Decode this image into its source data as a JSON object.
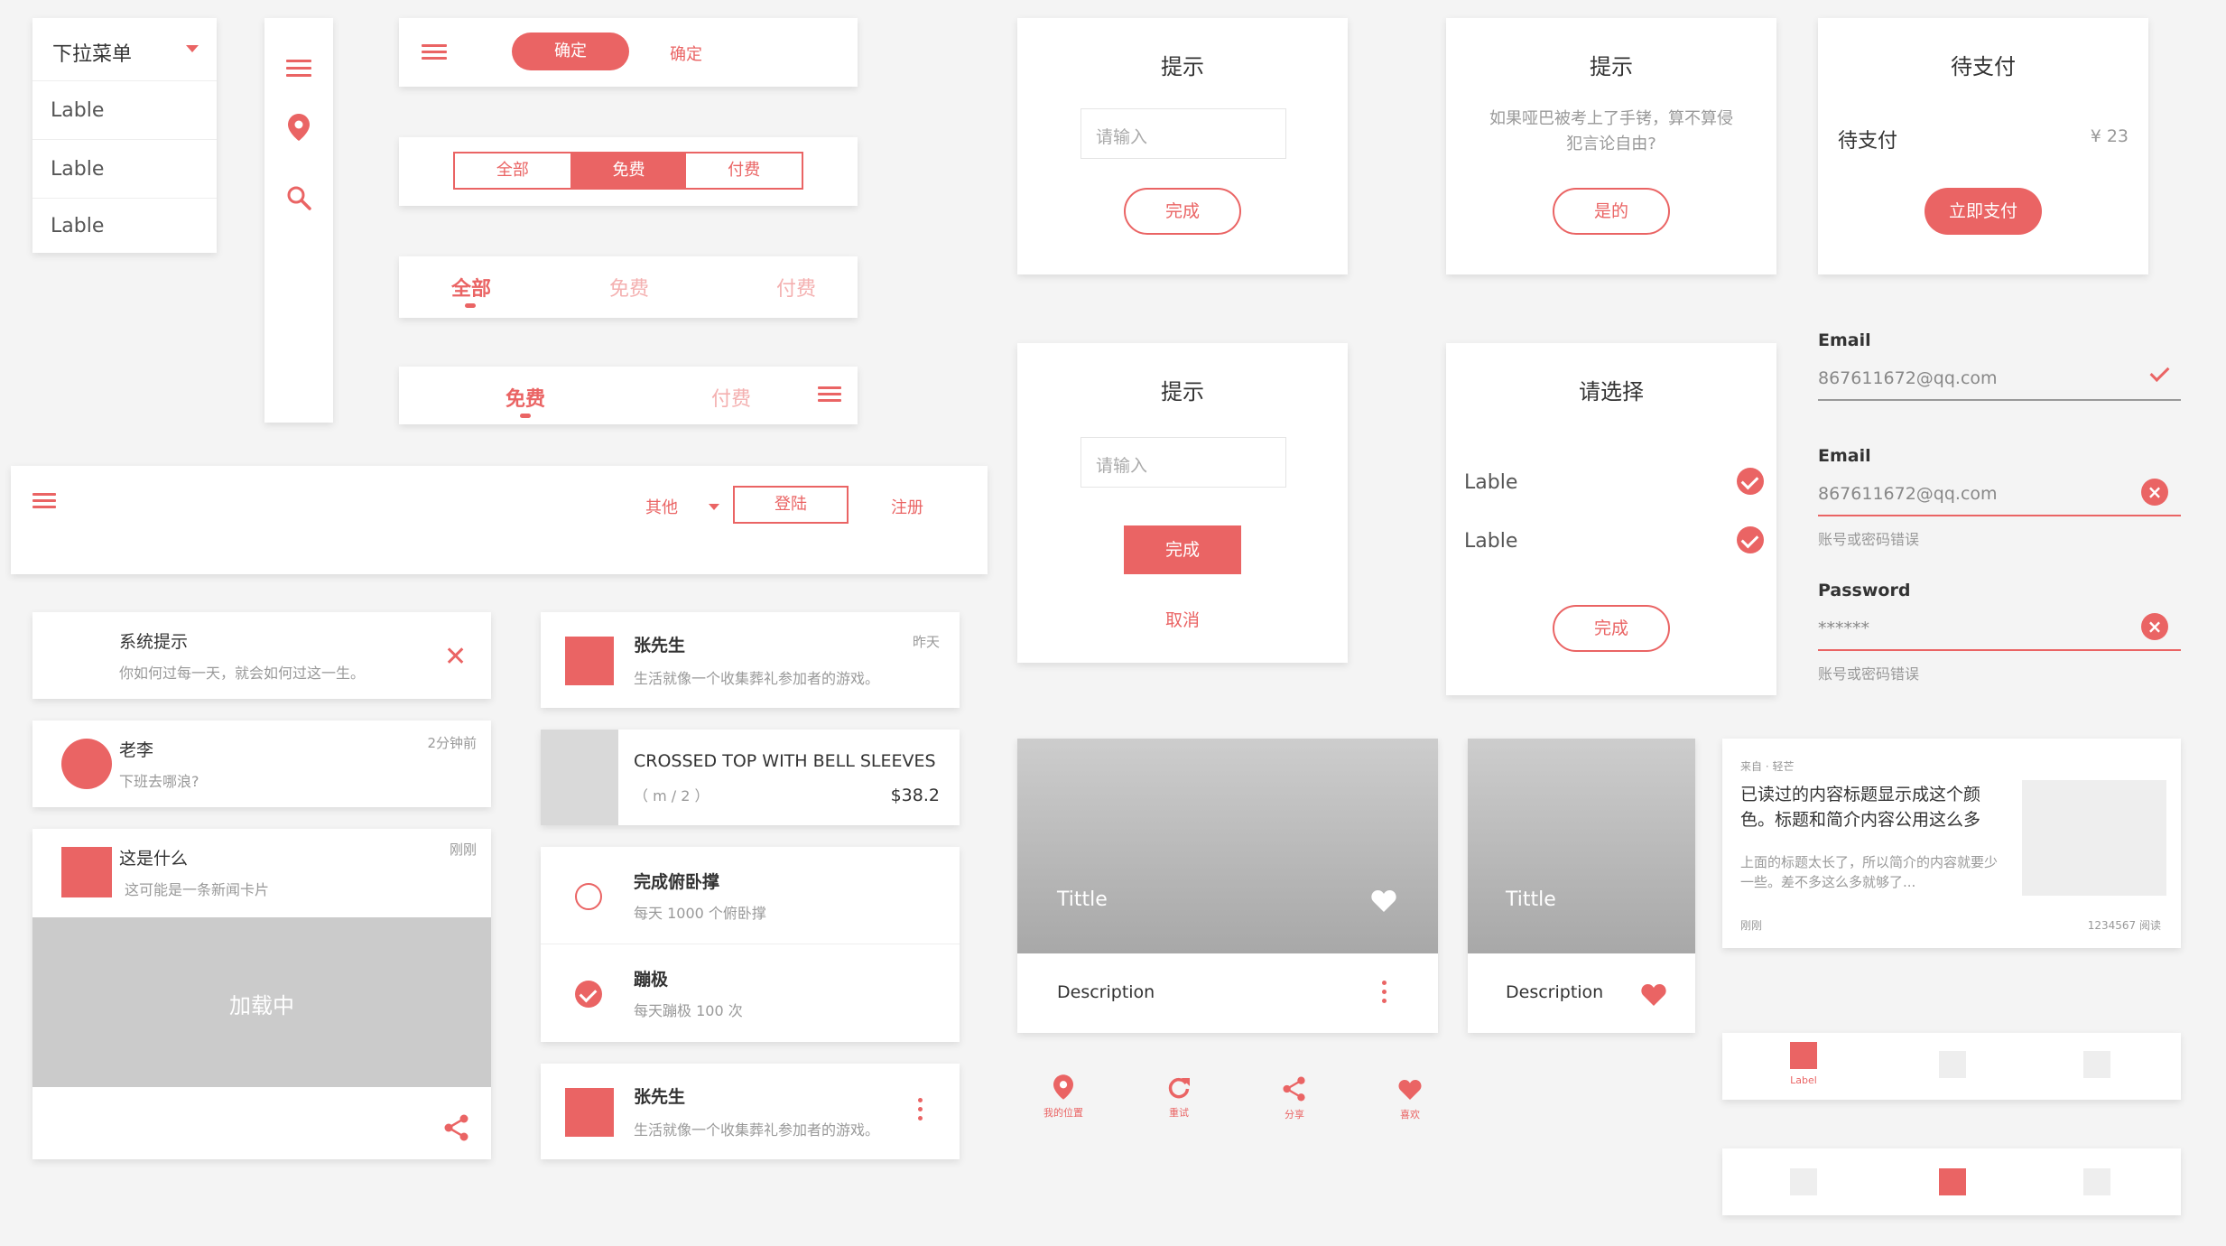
{
  "dropdown": {
    "header": "下拉菜单",
    "items": [
      "Lable",
      "Lable",
      "Lable"
    ]
  },
  "topbar1": {
    "btn_filled": "确定",
    "btn_text": "确定"
  },
  "segment": [
    "全部",
    "免费",
    "付费"
  ],
  "tabs1": [
    "全部",
    "免费",
    "付费"
  ],
  "tabs2": [
    "免费",
    "付费"
  ],
  "navbar": {
    "other": "其他",
    "login": "登陆",
    "register": "注册"
  },
  "dialog1": {
    "title": "提示",
    "placeholder": "请输入",
    "btn": "完成"
  },
  "dialog2": {
    "title": "提示",
    "text": "如果哑巴被考上了手铐，算不算侵犯言论自由?",
    "btn": "是的"
  },
  "dialog3": {
    "title": "待支付",
    "label": "待支付",
    "amount": "¥ 23",
    "btn": "立即支付"
  },
  "dialog4": {
    "title": "提示",
    "placeholder": "请输入",
    "btn": "完成",
    "cancel": "取消"
  },
  "dialog5": {
    "title": "请选择",
    "options": [
      "Lable",
      "Lable"
    ],
    "btn": "完成"
  },
  "form": {
    "email1_label": "Email",
    "email1_value": "867611672@qq.com",
    "email2_label": "Email",
    "email2_value": "867611672@qq.com",
    "email2_error": "账号或密码错误",
    "pwd_label": "Password",
    "pwd_value": "******",
    "pwd_error": "账号或密码错误"
  },
  "notify": {
    "title": "系统提示",
    "text": "你如何过每一天，就会如何过这一生。"
  },
  "chat": {
    "name": "老李",
    "text": "下班去哪浪?",
    "time": "2分钟前"
  },
  "news": {
    "title": "这是什么",
    "text": "这可能是一条新闻卡片",
    "time": "刚刚",
    "loading": "加载中"
  },
  "list1": {
    "name": "张先生",
    "text": "生活就像一个收集葬礼参加者的游戏。",
    "time": "昨天"
  },
  "product": {
    "name": "CROSSED TOP WITH BELL SLEEVES",
    "size": "（ m / 2 ）",
    "price": "$38.2"
  },
  "tasks": [
    {
      "title": "完成俯卧撑",
      "sub": "每天 1000 个俯卧撑",
      "done": false
    },
    {
      "title": "蹦极",
      "sub": "每天蹦极 100 次",
      "done": true
    }
  ],
  "list2": {
    "name": "张先生",
    "text": "生活就像一个收集葬礼参加者的游戏。"
  },
  "media1": {
    "title": "Tittle",
    "desc": "Description"
  },
  "media2": {
    "title": "Tittle",
    "desc": "Description"
  },
  "article": {
    "source": "来自 · 轻芒",
    "title": "已读过的内容标题显示成这个颜色。标题和简介内容公用这么多",
    "text": "上面的标题太长了，所以简介的内容就要少一些。差不多这么多就够了...",
    "time": "刚刚",
    "reads": "1234567 阅读"
  },
  "actions": [
    "我的位置",
    "重试",
    "分享",
    "喜欢"
  ],
  "bottomnav": {
    "label": "Label"
  },
  "colors": {
    "accent": "#ea6464",
    "bg": "#f4f4f4",
    "gray": "#cccccc"
  }
}
